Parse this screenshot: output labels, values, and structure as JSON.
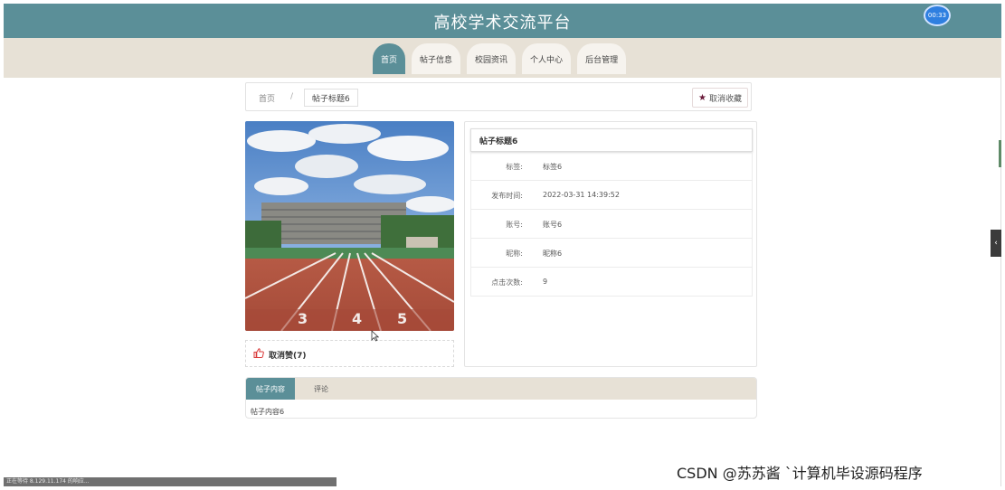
{
  "header": {
    "title": "高校学术交流平台",
    "timer": "00:33"
  },
  "nav": {
    "items": [
      {
        "label": "首页"
      },
      {
        "label": "帖子信息"
      },
      {
        "label": "校园资讯"
      },
      {
        "label": "个人中心"
      },
      {
        "label": "后台管理"
      }
    ],
    "active_index": 0
  },
  "breadcrumb": {
    "home": "首页",
    "separator": "/",
    "current": "帖子标题6"
  },
  "actions": {
    "unfavorite_label": "取消收藏",
    "unlike_label": "取消赞(7)"
  },
  "post": {
    "title": "帖子标题6",
    "fields": [
      {
        "label": "标签:",
        "value": "标签6"
      },
      {
        "label": "发布时间:",
        "value": "2022-03-31 14:39:52"
      },
      {
        "label": "账号:",
        "value": "账号6"
      },
      {
        "label": "昵称:",
        "value": "昵称6"
      },
      {
        "label": "点击次数:",
        "value": "9"
      }
    ]
  },
  "content_tabs": {
    "tabs": [
      {
        "label": "帖子内容"
      },
      {
        "label": "评论"
      }
    ],
    "body": "帖子内容6"
  },
  "status_bar": "正在等待 8.129.11.174 的响应...",
  "watermark": "CSDN @苏苏酱 `计算机毕设源码程序",
  "colors": {
    "header_bg": "#5b8f98",
    "nav_bg": "#e7e1d6",
    "accent": "#5b8f98",
    "favorite_star": "#6a1b3a"
  }
}
